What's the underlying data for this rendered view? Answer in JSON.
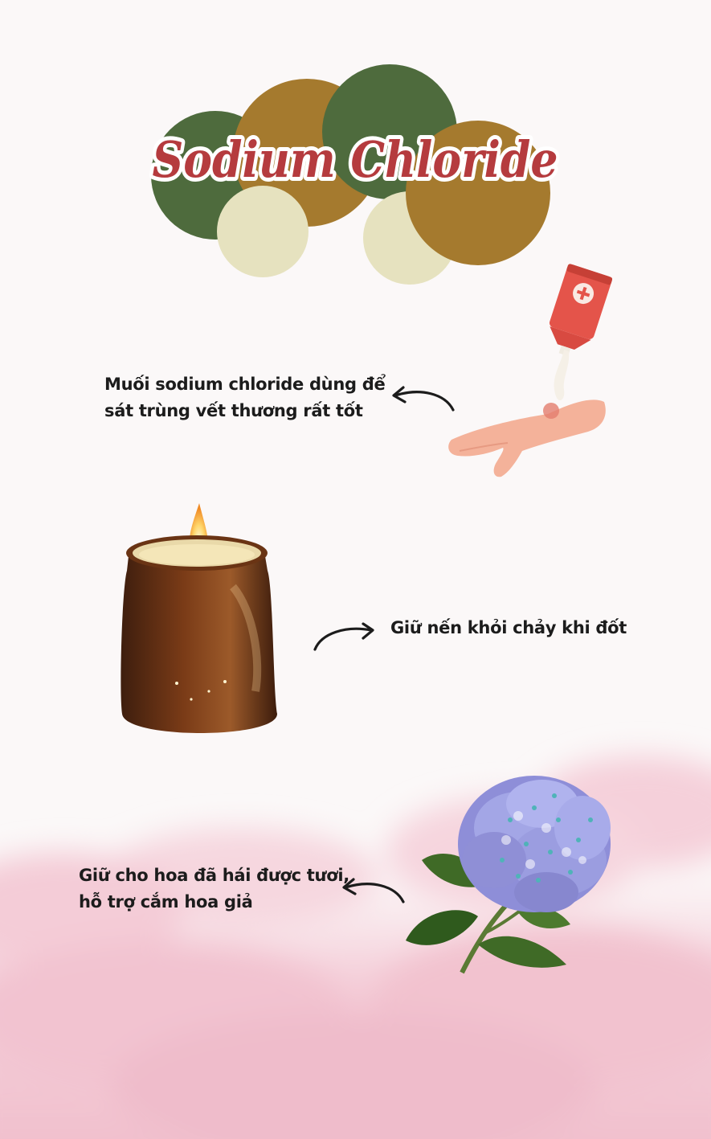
{
  "title": "Sodium Chloride",
  "colors": {
    "green": "#4e6b3d",
    "ochre": "#a57a2e",
    "cream": "#e6e2bf",
    "title_red": "#b53b3e",
    "pink": "#f2bfcd"
  },
  "uses": [
    {
      "line1": "Muối sodium chloride dùng để",
      "line2": "sát trùng vết thương rất tốt",
      "icon": "ointment-on-hand-illustration"
    },
    {
      "line1": "Giữ nến khỏi chảy khi đốt",
      "icon": "candle-jar-illustration"
    },
    {
      "line1": "Giữ cho hoa đã hái được tươi,",
      "line2": "hỗ trợ cắm hoa giả",
      "icon": "hydrangea-illustration"
    }
  ]
}
